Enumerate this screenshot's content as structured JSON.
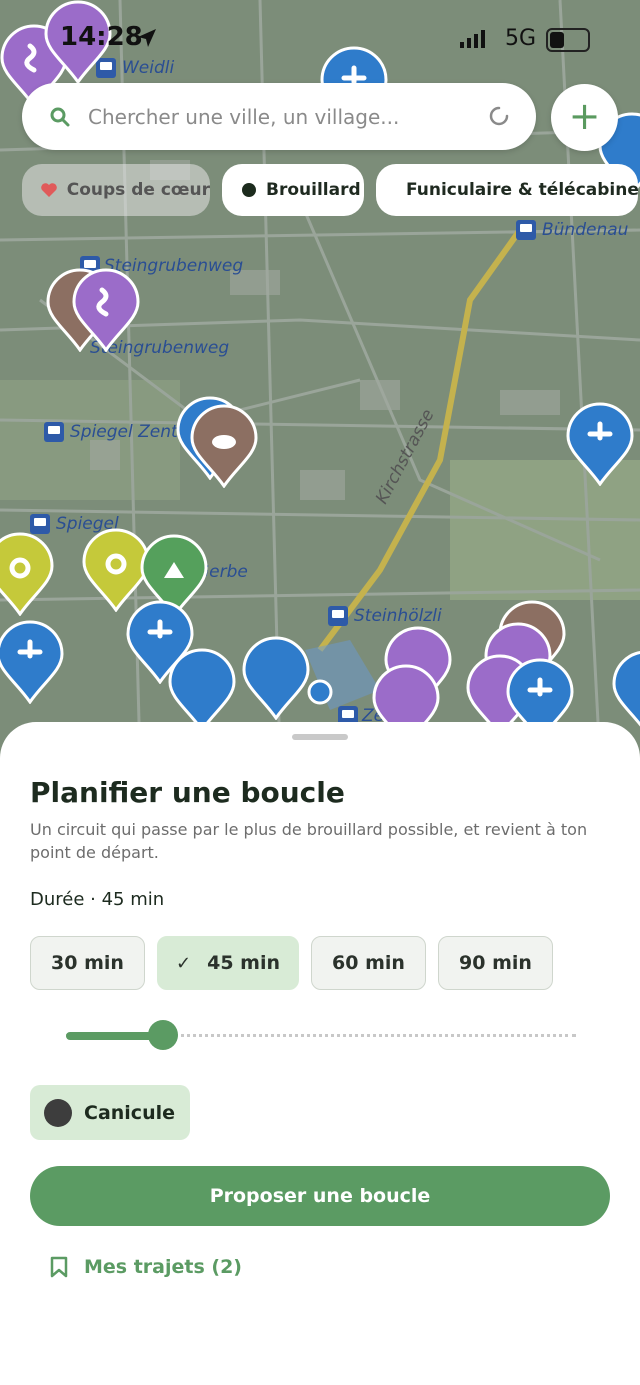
{
  "status_bar": {
    "time": "14:28",
    "network": "5G"
  },
  "search": {
    "placeholder": "Chercher une ville, un village..."
  },
  "filters": [
    {
      "label": "Coups de cœur",
      "color": "#e05a5a"
    },
    {
      "label": "Brouillard",
      "color": "#1c2b1d"
    },
    {
      "label": "Funiculaire & télécabine",
      "color": "#9b6cc9"
    }
  ],
  "map": {
    "labels": [
      "Weidli",
      "Steingrubenweg",
      "Steingrubenweg",
      "Spiegel Zentrum",
      "Spiegel",
      "Kirchstrasse",
      "Steinhölzli",
      "Bündenau",
      "Zentral",
      "Gerbe"
    ]
  },
  "sheet": {
    "title": "Planifier une boucle",
    "description": "Un circuit qui passe par le plus de brouillard possible, et revient à ton point de départ.",
    "duration_label": "Durée · 45 min",
    "durations": [
      "30 min",
      "45 min",
      "60 min",
      "90 min"
    ],
    "selected_duration": "45 min",
    "slider_fraction": 0.19,
    "canicule_label": "Canicule",
    "cta_label": "Proposer une boucle",
    "trips_label": "Mes trajets (2)"
  },
  "colors": {
    "accent": "#5b9b63",
    "pin_blue": "#2f7ccb",
    "pin_purple": "#9b6cc9",
    "pin_brown": "#8c6f62",
    "pin_olive": "#c5c93a",
    "pin_green": "#55a05c"
  }
}
